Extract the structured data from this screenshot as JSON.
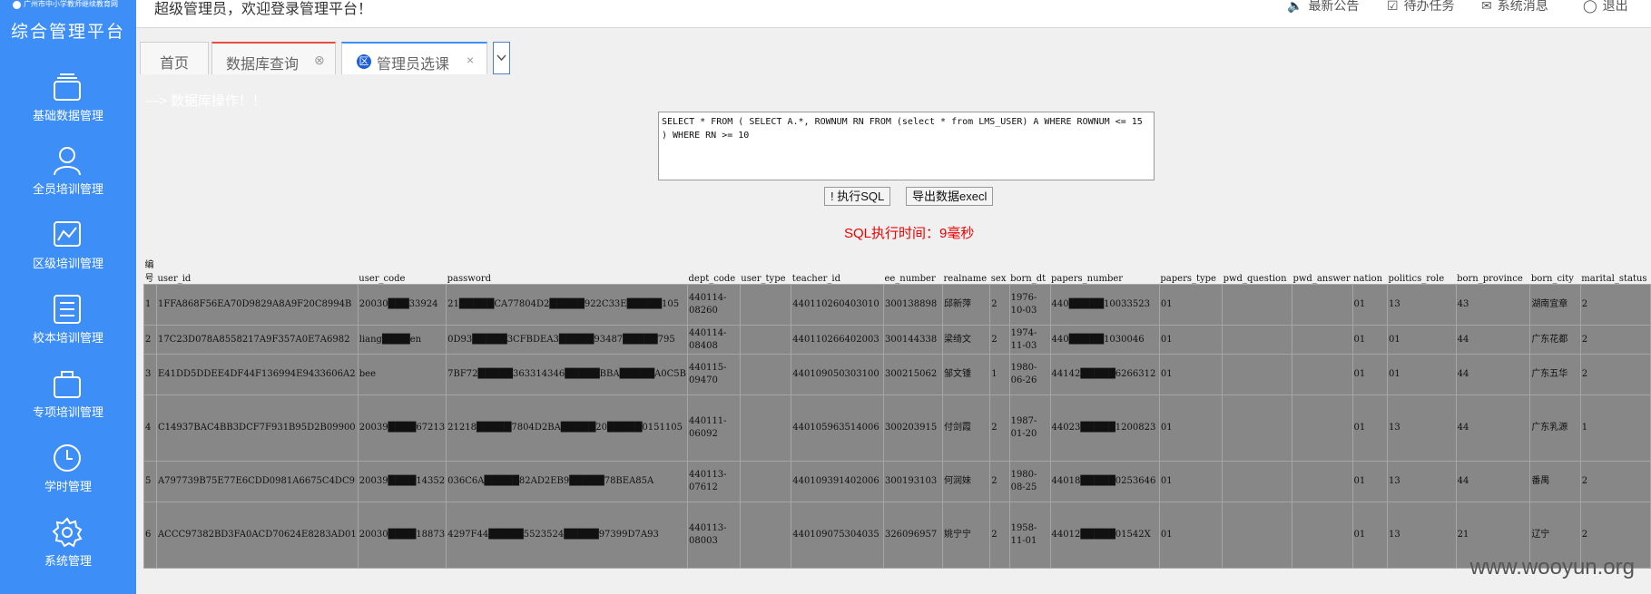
{
  "sidebar": {
    "logo_text": "广州市中小学教师继续教育网",
    "title": "综合管理平台",
    "items": [
      {
        "label": "基础数据管理",
        "icon": "stack-icon"
      },
      {
        "label": "全员培训管理",
        "icon": "user-icon"
      },
      {
        "label": "区级培训管理",
        "icon": "chart-icon"
      },
      {
        "label": "校本培训管理",
        "icon": "list-icon"
      },
      {
        "label": "专项培训管理",
        "icon": "briefcase-icon"
      },
      {
        "label": "学时管理",
        "icon": "clock-icon"
      },
      {
        "label": "系统管理",
        "icon": "gear-icon"
      }
    ]
  },
  "header": {
    "welcome": "超级管理员，欢迎登录管理平台！",
    "links": [
      {
        "label": "最新公告",
        "icon": "speaker-icon"
      },
      {
        "label": "待办任务",
        "icon": "checkbox-icon"
      },
      {
        "label": "系统消息",
        "icon": "mail-icon"
      },
      {
        "label": "退出",
        "icon": "power-icon"
      }
    ]
  },
  "tabs": [
    {
      "label": "首页"
    },
    {
      "label": "数据库查询"
    },
    {
      "label": "管理员选课",
      "badge": "区"
    }
  ],
  "breadcrumb": "---> 数据库操作！！",
  "query": {
    "sql": "SELECT * FROM ( SELECT A.*, ROWNUM RN FROM (select * from LMS_USER) A WHERE ROWNUM <= 15 ) WHERE RN >= 10",
    "execute_label": "! 执行SQL",
    "export_label": "导出数据execl",
    "exec_time": "SQL执行时间：9毫秒"
  },
  "table": {
    "headers": [
      "编号",
      "user_id",
      "user_code",
      "password",
      "dept_code",
      "user_type",
      "teacher_id",
      "ee_number",
      "realname",
      "sex",
      "born_dt",
      "papers_number",
      "papers_type",
      "pwd_question",
      "pwd_answer",
      "nation",
      "politics_role",
      "born_province",
      "born_city",
      "marital_status"
    ],
    "rows": [
      [
        "1",
        "1FFA868F56EA70D9829A8A9F20C8994B",
        "20030███33924",
        "21█████CA77804D2█████922C33E█████105",
        "440114-08260",
        "",
        "440110260403010",
        "300138898",
        "邱新萍",
        "2",
        "1976-10-03",
        "440█████10033523",
        "01",
        "",
        "",
        "01",
        "13",
        "43",
        "湖南宜章",
        "2"
      ],
      [
        "2",
        "17C23D078A8558217A9F357A0E7A6982",
        "liang████en",
        "0D93█████3CFBDEA3█████93487█████795",
        "440114-08408",
        "",
        "440110266402003",
        "300144338",
        "梁绮文",
        "2",
        "1974-11-03",
        "440█████1030046",
        "01",
        "",
        "",
        "01",
        "01",
        "44",
        "广东花都",
        "2"
      ],
      [
        "3",
        "E41DD5DDEE4DF44F136994E9433606A2",
        "bee",
        "7BF72█████363314346█████BBA█████A0C5B",
        "440115-09470",
        "",
        "440109050303100",
        "300215062",
        "邹文锺",
        "1",
        "1980-06-26",
        "44142█████6266312",
        "01",
        "",
        "",
        "01",
        "01",
        "44",
        "广东五华",
        "2"
      ],
      [
        "4",
        "C14937BAC4BB3DCF7F931B95D2B09900",
        "20039████67213",
        "21218█████7804D2BA█████20█████0151105",
        "440111-06092",
        "",
        "440105963514006",
        "300203915",
        "付剑霞",
        "2",
        "1987-01-20",
        "44023█████1200823",
        "01",
        "",
        "",
        "01",
        "13",
        "44",
        "广东乳源",
        "1"
      ],
      [
        "5",
        "A797739B75E77E6CDD0981A6675C4DC9",
        "20039████14352",
        "036C6A█████82AD2EB9█████78BEA85A",
        "440113-07612",
        "",
        "440109391402006",
        "300193103",
        "何润妹",
        "2",
        "1980-08-25",
        "44018█████0253646",
        "01",
        "",
        "",
        "01",
        "13",
        "44",
        "番禺",
        "2"
      ],
      [
        "6",
        "ACCC97382BD3FA0ACD70624E8283AD01",
        "20030████18873",
        "4297F44█████5523524█████97399D7A93",
        "440113-08003",
        "",
        "440109075304035",
        "326096957",
        "姚宁宁",
        "2",
        "1958-11-01",
        "44012█████01542X",
        "01",
        "",
        "",
        "01",
        "13",
        "21",
        "辽宁",
        "2"
      ]
    ],
    "row_heights": [
      45,
      32,
      45,
      73,
      45,
      73
    ]
  },
  "watermark": "www.wooyun.org",
  "colors": {
    "sidebar": "#3e8ef7",
    "table_cell": "#878787",
    "exec_time": "#e00000"
  }
}
